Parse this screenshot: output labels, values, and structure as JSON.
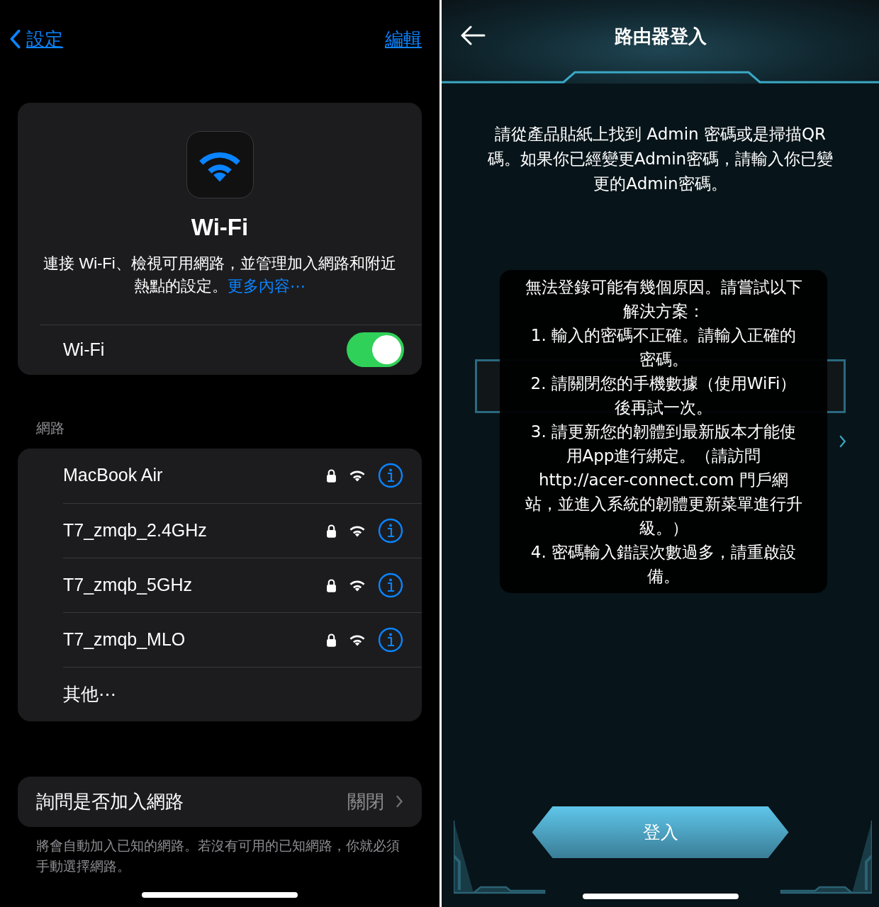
{
  "settings": {
    "back_label": "設定",
    "edit_label": "編輯",
    "wifi_card": {
      "title": "Wi-Fi",
      "description": "連接 Wi-Fi、檢視可用網路，並管理加入網路和附近熱點的設定。",
      "more_link": "更多內容⋯",
      "toggle_label": "Wi-Fi",
      "on": true
    },
    "networks_header": "網路",
    "networks": [
      {
        "kind": "network",
        "name": "MacBook Air",
        "locked": true
      },
      {
        "kind": "network",
        "name": "T7_zmqb_2.4GHz",
        "locked": true
      },
      {
        "kind": "network",
        "name": "T7_zmqb_5GHz",
        "locked": true
      },
      {
        "kind": "network",
        "name": "T7_zmqb_MLO",
        "locked": true
      },
      {
        "kind": "other",
        "name": "其他⋯"
      }
    ],
    "ask_to_join": {
      "label": "詢問是否加入網路",
      "value": "關閉"
    },
    "ask_to_join_note": "將會自動加入已知的網路。若沒有可用的已知網路，你就必須手動選擇網路。"
  },
  "router_login": {
    "title": "路由器登入",
    "instructions": "請從產品貼紙上找到 Admin 密碼或是掃描QR碼。如果你已經變更Admin密碼，請輸入你已變更的Admin密碼。",
    "toast": [
      "無法登錄可能有幾個原因。請嘗試以下解決方案：",
      "1. 輸入的密碼不正確。請輸入正確的密碼。",
      "2. 請關閉您的手機數據（使用WiFi）後再試一次。",
      "3. 請更新您的韌體到最新版本才能使用App進行綁定。（請訪問 http://acer-connect.com 門戶網站，並進入系統的韌體更新菜單進行升級。）",
      "4. 密碼輸入錯誤次數過多，請重啟設備。"
    ],
    "login_button": "登入"
  }
}
